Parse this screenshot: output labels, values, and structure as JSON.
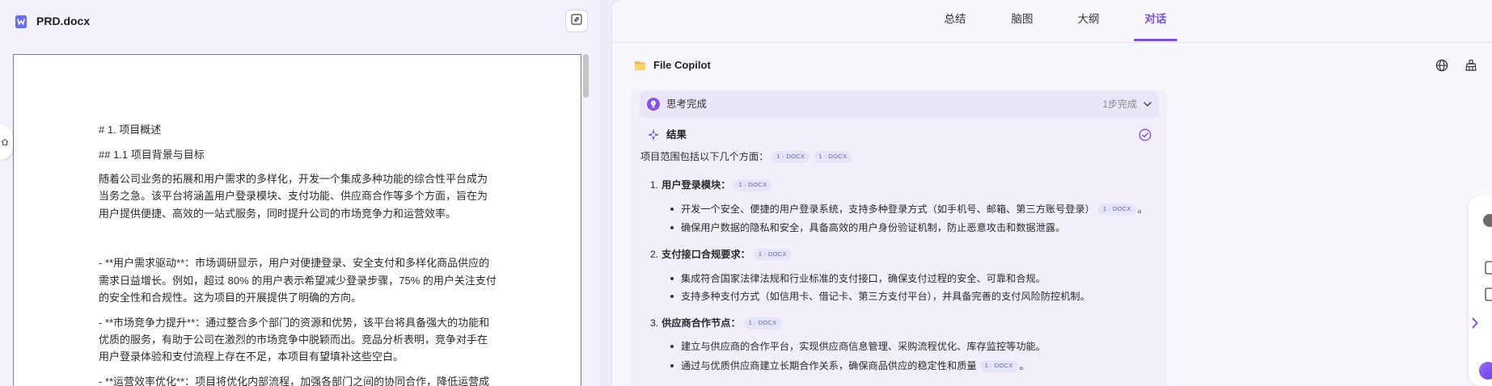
{
  "window": {
    "file_name": "PRD.docx"
  },
  "document": {
    "lines": [
      "# 1. 项目概述",
      "## 1.1 项目背景与目标",
      "随着公司业务的拓展和用户需求的多样化，开发一个集成多种功能的综合性平台成为",
      "当务之急。该平台将涵盖用户登录模块、支付功能、供应商合作等多个方面，旨在为",
      "用户提供便捷、高效的一站式服务，同时提升公司的市场竞争力和运营效率。",
      "- **用户需求驱动**：市场调研显示，用户对便捷登录、安全支付和多样化商品供应的",
      "需求日益增长。例如，超过 80% 的用户表示希望减少登录步骤，75% 的用户关注支付",
      "的安全性和合规性。这为项目的开展提供了明确的方向。",
      "- **市场竞争力提升**：通过整合多个部门的资源和优势，该平台将具备强大的功能和",
      "优质的服务，有助于公司在激烈的市场竞争中脱颖而出。竞品分析表明，竞争对手在",
      "用户登录体验和支付流程上存在不足，本项目有望填补这些空白。",
      "- **运营效率优化**：项目将优化内部流程，加强各部门之间的协同合作，降低运营成"
    ]
  },
  "tabs": [
    {
      "label": "总结",
      "active": false
    },
    {
      "label": "脑图",
      "active": false
    },
    {
      "label": "大纲",
      "active": false
    },
    {
      "label": "对话",
      "active": true
    }
  ],
  "copilot": {
    "title": "File Copilot"
  },
  "thinking": {
    "label": "思考完成",
    "status": "1步完成"
  },
  "result": {
    "label": "结果",
    "intro": "项目范围包括以下几个方面：",
    "intro_citations": [
      "1 · DOCX",
      "1 · DOCX"
    ],
    "sections": [
      {
        "number": "1.",
        "title": "用户登录模块：",
        "citation": "1 · DOCX",
        "bullets": [
          {
            "text": "开发一个安全、便捷的用户登录系统，支持多种登录方式（如手机号、邮箱、第三方账号登录）",
            "citation": "1 · DOCX",
            "tail": "。"
          },
          {
            "text": "确保用户数据的隐私和安全，具备高效的用户身份验证机制，防止恶意攻击和数据泄露。"
          }
        ]
      },
      {
        "number": "2.",
        "title": "支付接口合规要求：",
        "citation": "1 · DOCX",
        "bullets": [
          {
            "text": "集成符合国家法律法规和行业标准的支付接口，确保支付过程的安全、可靠和合规。"
          },
          {
            "text": "支持多种支付方式（如信用卡、借记卡、第三方支付平台），并具备完善的支付风险防控机制。"
          }
        ]
      },
      {
        "number": "3.",
        "title": "供应商合作节点：",
        "citation": "1 · DOCX",
        "bullets": [
          {
            "text": "建立与供应商的合作平台，实现供应商信息管理、采购流程优化、库存监控等功能。"
          },
          {
            "text": "通过与优质供应商建立长期合作关系，确保商品供应的稳定性和质量",
            "citation": "1 · DOCX",
            "tail": "。"
          }
        ]
      }
    ]
  },
  "colors": {
    "accent": "#7b4fe0",
    "citation_bg": "#e6e4f7",
    "citation_text": "#5b60b8",
    "file_icon": "#6470f3",
    "folder": "#f5b33c"
  },
  "icons": {
    "file": "word-doc-icon",
    "expand": "expand-icon",
    "sidebar_toggle": "home-icon",
    "copilot": "folder-icon",
    "language": "globe-icon",
    "clear": "broom-icon",
    "thinking": "bulb-icon",
    "result": "sparkle-icon",
    "done": "check-circle-icon",
    "collapse": "chevron-down-icon",
    "side_expand": "chevron-right-icon"
  }
}
